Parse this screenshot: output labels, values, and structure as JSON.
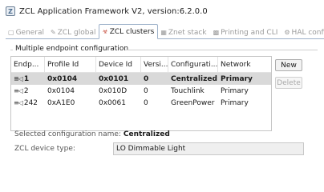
{
  "window": {
    "title": "ZCL Application Framework V2, version:6.2.0.0"
  },
  "tabs": [
    {
      "label": "General",
      "icon": "general-icon",
      "active": false
    },
    {
      "label": "ZCL global",
      "icon": "zcl-global-icon",
      "active": false
    },
    {
      "label": "ZCL clusters",
      "icon": "zcl-clusters-icon",
      "active": true
    },
    {
      "label": "Znet stack",
      "icon": "znet-stack-icon",
      "active": false
    },
    {
      "label": "Printing and CLI",
      "icon": "printing-icon",
      "active": false
    },
    {
      "label": "HAL config",
      "icon": "hal-config-icon",
      "active": false
    }
  ],
  "endpoint_config": {
    "group_label": "Multiple endpoint configuration",
    "columns": [
      "Endp...",
      "Profile Id",
      "Device Id",
      "Versi...",
      "Configurati...",
      "Network"
    ],
    "rows": [
      {
        "endpoint": "1",
        "profile_id": "0x0104",
        "device_id": "0x0101",
        "version": "0",
        "configuration": "Centralized",
        "network": "Primary",
        "selected": true
      },
      {
        "endpoint": "2",
        "profile_id": "0x0104",
        "device_id": "0x010D",
        "version": "0",
        "configuration": "Touchlink",
        "network": "Primary",
        "selected": false
      },
      {
        "endpoint": "242",
        "profile_id": "0xA1E0",
        "device_id": "0x0061",
        "version": "0",
        "configuration": "GreenPower",
        "network": "Primary",
        "selected": false
      }
    ],
    "buttons": {
      "new": "New",
      "delete": "Delete"
    }
  },
  "selected_config": {
    "label": "Selected configuration name:",
    "value": "Centralized"
  },
  "device_type": {
    "label": "ZCL device type:",
    "value": "LO Dimmable Light"
  },
  "colors": {
    "accent": "#c23c2a",
    "selection": "#d9d9d9",
    "tab_border": "#9db1c9"
  }
}
